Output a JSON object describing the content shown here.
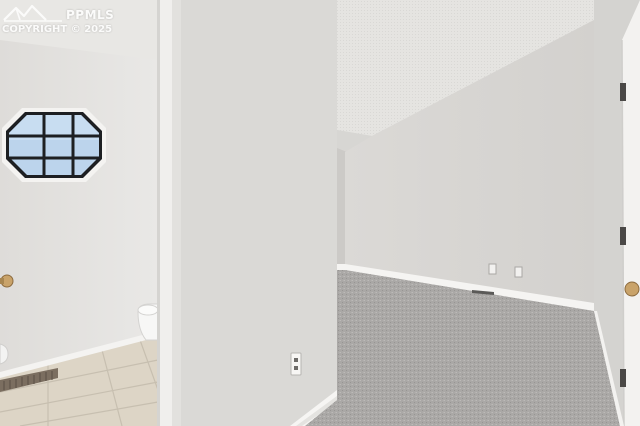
{
  "watermark": {
    "brand": "PPMLS",
    "copyright": "COPYRIGHT © 2025"
  },
  "colors": {
    "wall_light": "#e3e2df",
    "wall_shade": "#cfcdca",
    "ceiling": "#e6e5e2",
    "carpet": "#a9a7a5",
    "tile": "#ddd5c6",
    "trim": "#f4f3f1"
  }
}
